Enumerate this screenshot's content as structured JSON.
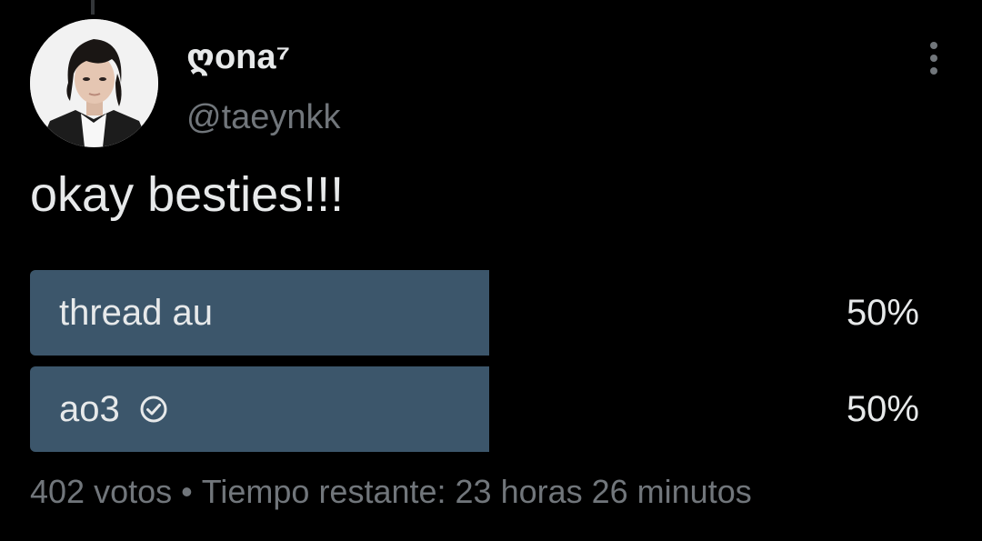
{
  "author": {
    "display_name": "ღona⁷",
    "handle": "@taeynkk",
    "avatar_icon": "profile-photo"
  },
  "tweet": {
    "text": "okay besties!!!"
  },
  "poll": {
    "options": [
      {
        "label": "thread au",
        "percent_text": "50%",
        "percent": 50,
        "selected": false
      },
      {
        "label": "ao3",
        "percent_text": "50%",
        "percent": 50,
        "selected": true,
        "icon": "check-circle-icon"
      }
    ],
    "votes_text": "402 votos",
    "separator": "•",
    "time_remaining": "Tiempo restante: 23 horas 26 minutos"
  },
  "more_icon": "vertical-dots-icon",
  "colors": {
    "background": "#000000",
    "text_primary": "#e7e9ea",
    "text_secondary": "#71767b",
    "poll_bar": "#3c566b"
  }
}
